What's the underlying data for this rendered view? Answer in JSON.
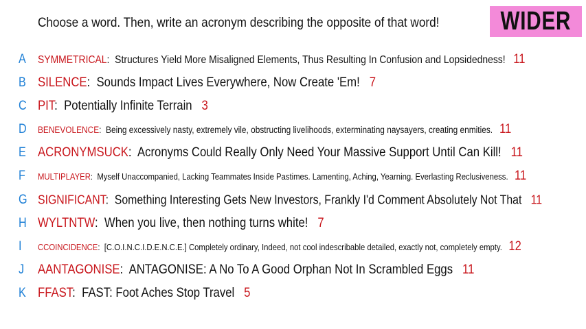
{
  "prompt": "Choose a word. Then, write an acronym describing the opposite of that word!",
  "badge": "WIDER",
  "colors": {
    "letter": "#1d7fd6",
    "word": "#c8151b",
    "badge_bg": "#f38ad9"
  },
  "rows": [
    {
      "letter": "A",
      "word": "SYMMETRICAL",
      "text": "Structures Yield More Misaligned Elements, Thus Resulting In Confusion and Lopsidedness!",
      "count": "11"
    },
    {
      "letter": "B",
      "word": "SILENCE",
      "text": "Sounds Impact Lives Everywhere, Now Create 'Em!",
      "count": "7"
    },
    {
      "letter": "C",
      "word": "PIT",
      "text": "Potentially Infinite Terrain",
      "count": "3"
    },
    {
      "letter": "D",
      "word": "BENEVOLENCE",
      "text": "Being excessively nasty, extremely vile, obstructing livelihoods, exterminating naysayers, creating enmities.",
      "count": "11"
    },
    {
      "letter": "E",
      "word": "ACRONYMSUCK",
      "text": "Acronyms Could Really Only Need Your Massive Support Until Can Kill!",
      "count": "11"
    },
    {
      "letter": "F",
      "word": "MULTIPLAYER",
      "text": "Myself Unaccompanied, Lacking Teammates Inside Pastimes. Lamenting, Aching, Yearning. Everlasting Reclusiveness.",
      "count": "11"
    },
    {
      "letter": "G",
      "word": "SIGNIFICANT",
      "text": "Something Interesting Gets New Investors, Frankly I'd Comment Absolutely Not That",
      "count": "11"
    },
    {
      "letter": "H",
      "word": "WYLTNTW",
      "text": "When you live, then nothing turns white!",
      "count": "7"
    },
    {
      "letter": "I",
      "word": "CCOINCIDENCE",
      "text": "[C.O.I.N.C.I.D.E.N.C.E.] Completely ordinary, Indeed, not cool indescribable detailed, exactly not, completely empty.",
      "count": "12"
    },
    {
      "letter": "J",
      "word": "AANTAGONISE",
      "text": "ANTAGONISE: A No To A Good Orphan Not In Scrambled Eggs",
      "count": "11"
    },
    {
      "letter": "K",
      "word": "FFAST",
      "text": "FAST: Foot Aches Stop Travel",
      "count": "5"
    }
  ]
}
